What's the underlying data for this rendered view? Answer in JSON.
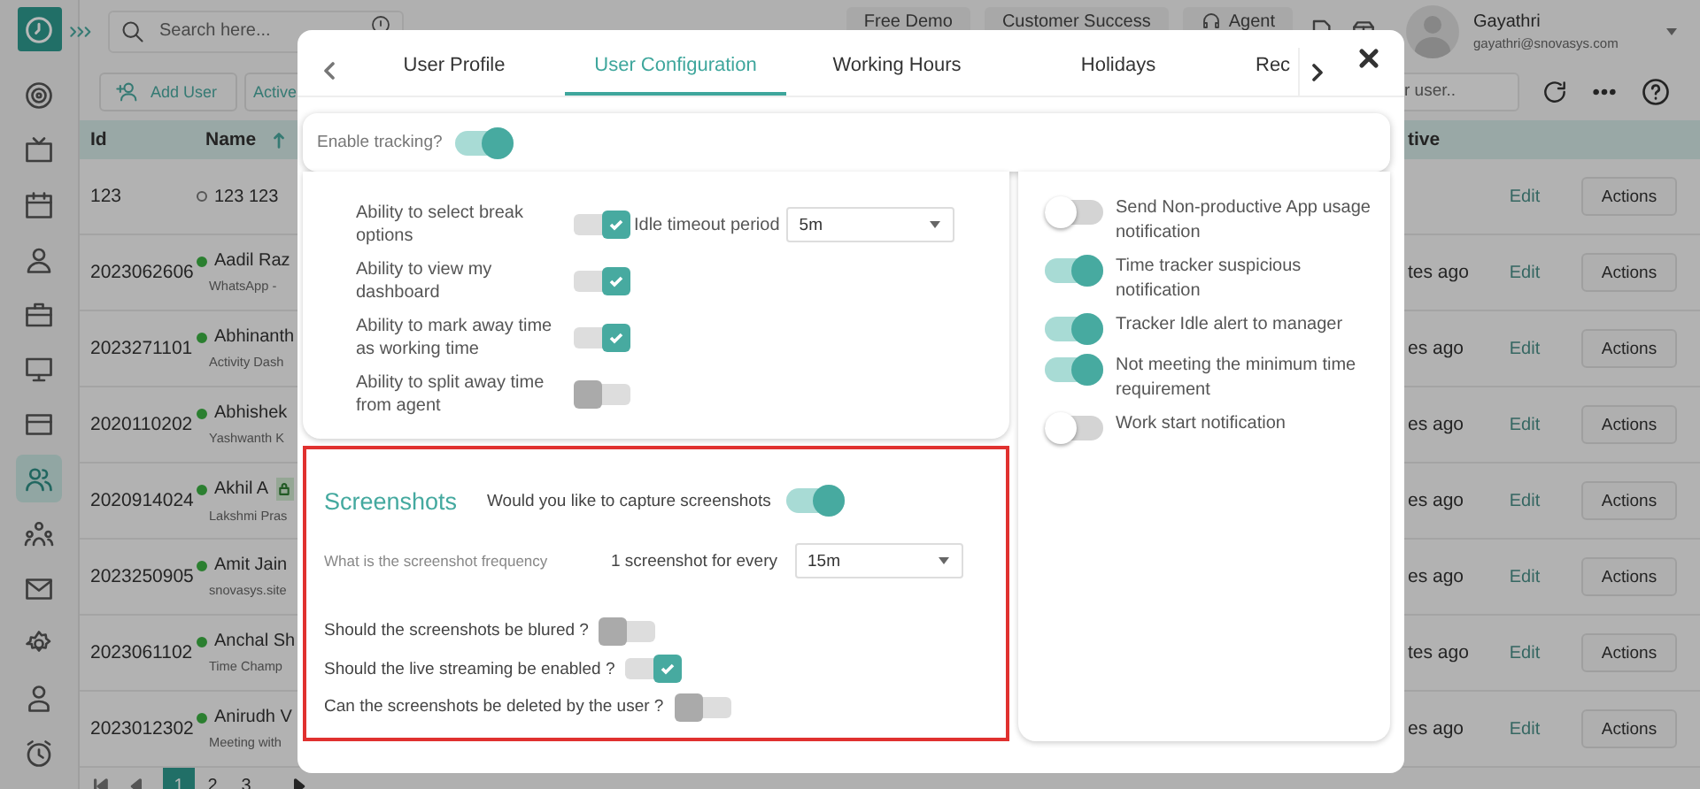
{
  "sidebar": {
    "items": [
      {
        "kind": "target",
        "selected": false
      },
      {
        "kind": "tv",
        "selected": false
      },
      {
        "kind": "calendar",
        "selected": false
      },
      {
        "kind": "user",
        "selected": false
      },
      {
        "kind": "briefcase",
        "selected": false
      },
      {
        "kind": "monitor",
        "selected": false
      },
      {
        "kind": "card",
        "selected": false
      },
      {
        "kind": "users",
        "selected": true
      },
      {
        "kind": "team",
        "selected": false
      },
      {
        "kind": "mail",
        "selected": false
      },
      {
        "kind": "gear",
        "selected": false
      },
      {
        "kind": "agent",
        "selected": false
      },
      {
        "kind": "alarm",
        "selected": false
      }
    ]
  },
  "topbar": {
    "search": {
      "placeholder": "Search here..."
    },
    "buttons": [
      "Free Demo",
      "Customer Success",
      "Agent"
    ],
    "user": {
      "name": "Gayathri",
      "email": "gayathri@snovasys.com"
    }
  },
  "toolbar": {
    "buttons": [
      "Add User",
      "Active"
    ],
    "search": {
      "placeholder": "r user.."
    }
  },
  "table": {
    "columns": [
      {
        "label": "Id",
        "sorted": false
      },
      {
        "label": "Name",
        "sorted": true
      },
      {
        "label": "tive",
        "sorted": false
      }
    ],
    "rows": [
      {
        "id": "123",
        "name": "123 123",
        "online": false,
        "locked": false,
        "edit": "Edit",
        "action": "Actions"
      },
      {
        "id": "2023062606",
        "name": "Aadil Raz",
        "detail": "WhatsApp -",
        "online": true,
        "locked": false,
        "time": "tes ago",
        "edit": "Edit",
        "action": "Actions"
      },
      {
        "id": "2023271101",
        "name": "Abhinanth",
        "detail": "Activity Dash",
        "online": true,
        "locked": false,
        "time": "es ago",
        "edit": "Edit",
        "action": "Actions"
      },
      {
        "id": "2020110202",
        "name": "Abhishek",
        "detail": "Yashwanth K",
        "online": true,
        "locked": false,
        "time": "es ago",
        "edit": "Edit",
        "action": "Actions"
      },
      {
        "id": "2020914024",
        "name": "Akhil A",
        "detail": "Lakshmi Pras",
        "online": true,
        "locked": true,
        "time": "es ago",
        "edit": "Edit",
        "action": "Actions"
      },
      {
        "id": "2023250905",
        "name": "Amit Jain",
        "detail": "snovasys.site",
        "online": true,
        "locked": false,
        "time": "es ago",
        "edit": "Edit",
        "action": "Actions"
      },
      {
        "id": "2023061102",
        "name": "Anchal Sh",
        "detail": "Time Champ",
        "online": true,
        "locked": false,
        "time": "tes ago",
        "edit": "Edit",
        "action": "Actions"
      },
      {
        "id": "2023012302",
        "name": "Anirudh V",
        "detail": "Meeting with",
        "online": true,
        "locked": false,
        "time": "es ago",
        "edit": "Edit",
        "action": "Actions"
      }
    ]
  },
  "pagination": {
    "pages": [
      {
        "label": "1",
        "selected": true
      },
      {
        "label": "2",
        "selected": false
      },
      {
        "label": "3",
        "selected": false
      }
    ]
  },
  "modal": {
    "tabs": [
      {
        "label": "User Profile",
        "selected": false
      },
      {
        "label": "User Configuration",
        "selected": true
      },
      {
        "label": "Working Hours",
        "selected": false
      },
      {
        "label": "Holidays",
        "selected": false
      },
      {
        "label": "Rec",
        "selected": false
      }
    ],
    "tracking": {
      "label": "Enable tracking?",
      "on": true
    },
    "general": [
      {
        "label": "Ability to select break options",
        "kind": "check",
        "on": true,
        "extra": {
          "label": "Idle timeout period",
          "value": "5m"
        }
      },
      {
        "label": "Ability to view my dashboard",
        "kind": "check",
        "on": true
      },
      {
        "label": "Ability to mark away time as working time",
        "kind": "check",
        "on": true
      },
      {
        "label": "Ability to split away time from agent",
        "kind": "check",
        "on": false
      }
    ],
    "notifications": [
      {
        "label": "Send Non-productive App usage notification",
        "kind": "switch",
        "on": false
      },
      {
        "label": "Time tracker suspicious notification",
        "kind": "switch",
        "on": true
      },
      {
        "label": "Tracker Idle alert to manager",
        "kind": "switch",
        "on": true
      },
      {
        "label": "Not meeting the minimum time requirement",
        "kind": "switch",
        "on": true
      },
      {
        "label": "Work start notification",
        "kind": "switch",
        "on": false
      }
    ],
    "screenshots": {
      "title": "Screenshots",
      "capture": {
        "label": "Would you like to capture screenshots",
        "on": true
      },
      "frequency": {
        "label": "What is the screenshot frequency",
        "prefix": "1 screenshot for every",
        "value": "15m"
      },
      "options": [
        {
          "label": "Should the screenshots be blured ?",
          "kind": "check",
          "on": false
        },
        {
          "label": "Should the live streaming be enabled ?",
          "kind": "check",
          "on": true
        },
        {
          "label": "Can the screenshots be deleted by the user ?",
          "kind": "check",
          "on": false
        }
      ]
    }
  }
}
